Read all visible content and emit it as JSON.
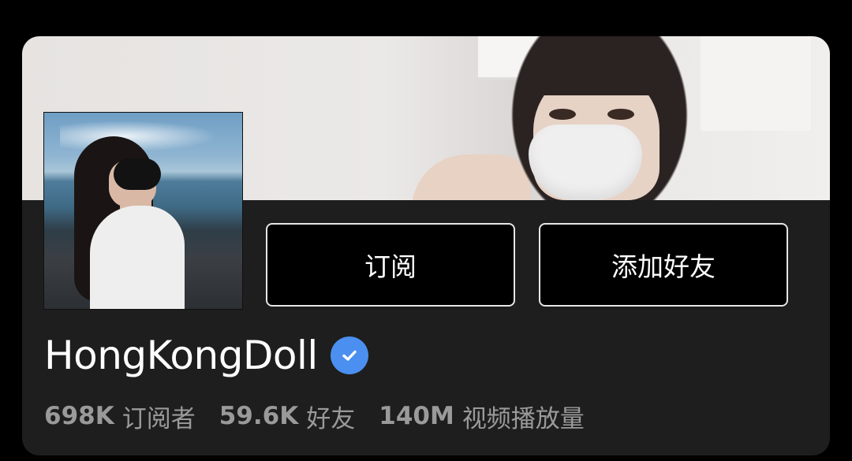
{
  "profile": {
    "name": "HongKongDoll",
    "verified": true,
    "verified_icon": "check-badge-icon",
    "verified_color": "#4b8ff0"
  },
  "actions": {
    "subscribe_label": "订阅",
    "add_friend_label": "添加好友"
  },
  "stats": [
    {
      "value": "698K",
      "label": "订阅者"
    },
    {
      "value": "59.6K",
      "label": "好友"
    },
    {
      "value": "140M",
      "label": "视频播放量"
    }
  ],
  "colors": {
    "background": "#000000",
    "card": "#1e1e1e",
    "text_primary": "#ffffff",
    "text_secondary": "#9a9a9a"
  }
}
